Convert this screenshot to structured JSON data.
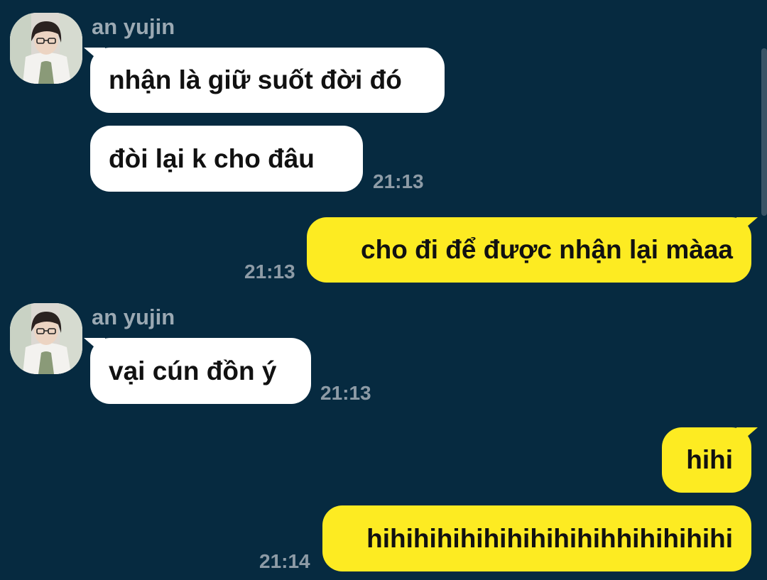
{
  "colors": {
    "background": "#062a40",
    "incoming_bubble": "#ffffff",
    "outgoing_bubble": "#fdeb22",
    "sender_name": "#9ba9b3",
    "timestamp": "#8d9ba6"
  },
  "messages": [
    {
      "direction": "incoming",
      "sender": "an yujin",
      "text": "nhận là giữ suốt đời đó"
    },
    {
      "direction": "incoming",
      "text": "đòi lại k cho đâu",
      "time": "21:13"
    },
    {
      "direction": "outgoing",
      "text": "cho đi để được nhận lại màaa",
      "time": "21:13"
    },
    {
      "direction": "incoming",
      "sender": "an yujin",
      "text": "vại cún đồn ý",
      "time": "21:13"
    },
    {
      "direction": "outgoing",
      "text": "hihi"
    },
    {
      "direction": "outgoing",
      "text": "hihihihihihihihihihihhihihihihi",
      "time": "21:14"
    }
  ]
}
